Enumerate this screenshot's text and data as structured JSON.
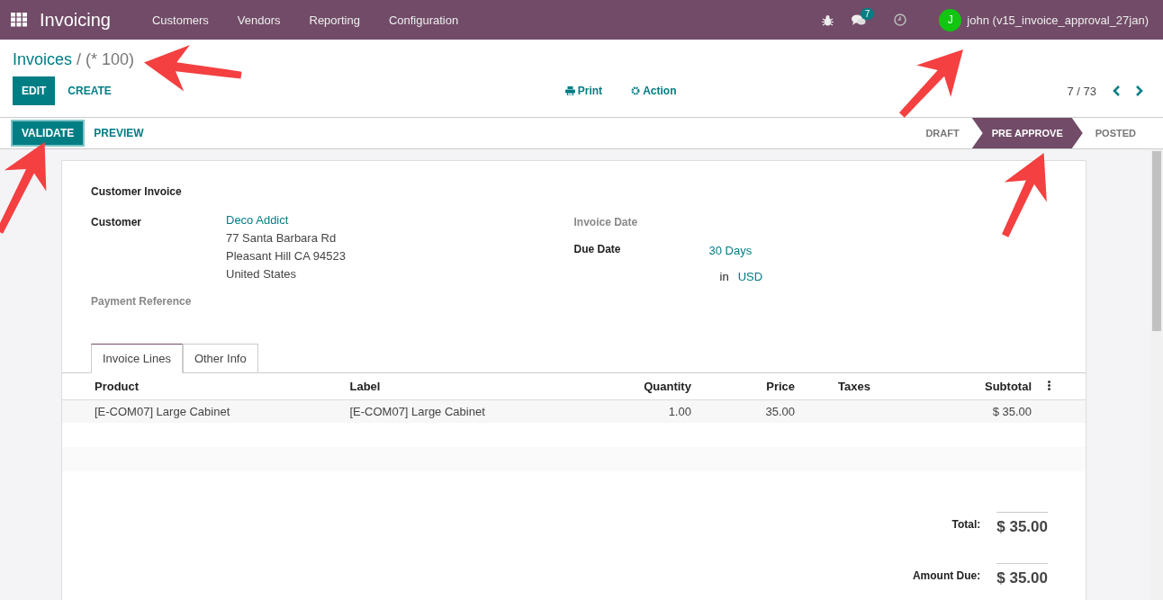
{
  "navbar": {
    "app_name": "Invoicing",
    "menu": [
      "Customers",
      "Vendors",
      "Reporting",
      "Configuration"
    ],
    "messages_count": "7",
    "user_initial": "J",
    "user_name": "john (v15_invoice_approval_27jan)"
  },
  "breadcrumb": {
    "parent": "Invoices",
    "separator": "/",
    "current": "(* 100)"
  },
  "buttons": {
    "edit": "EDIT",
    "create": "CREATE",
    "print": "Print",
    "action": "Action"
  },
  "pager": "7 / 73",
  "header_buttons": [
    {
      "label": "VALIDATE",
      "primary": true
    },
    {
      "label": "PREVIEW",
      "primary": false
    }
  ],
  "stages": [
    {
      "label": "DRAFT",
      "selected": false
    },
    {
      "label": "PRE APPROVE",
      "selected": true
    },
    {
      "label": "POSTED",
      "selected": false
    }
  ],
  "sheet": {
    "type_title": "Customer Invoice",
    "customer_label": "Customer",
    "customer": "Deco Addict",
    "address": [
      "77 Santa Barbara Rd",
      "Pleasant Hill CA 94523",
      "United States"
    ],
    "payment_reference_label": "Payment Reference",
    "invoice_date_label": "Invoice Date",
    "due_date_label": "Due Date",
    "due_date": "30 Days",
    "currency_prefix": "in",
    "currency": "USD"
  },
  "tabs": [
    {
      "label": "Invoice Lines",
      "selected": true
    },
    {
      "label": "Other Info",
      "selected": false
    }
  ],
  "table": {
    "columns": [
      "Product",
      "Label",
      "Quantity",
      "Price",
      "Taxes",
      "Subtotal"
    ],
    "rows": [
      [
        "[E-COM07] Large Cabinet",
        "[E-COM07] Large Cabinet",
        "1.00",
        "35.00",
        "",
        "$ 35.00"
      ]
    ]
  },
  "totals": [
    {
      "label": "Total:",
      "value": "$ 35.00"
    },
    {
      "label": "Amount Due:",
      "value": "$ 35.00"
    }
  ]
}
